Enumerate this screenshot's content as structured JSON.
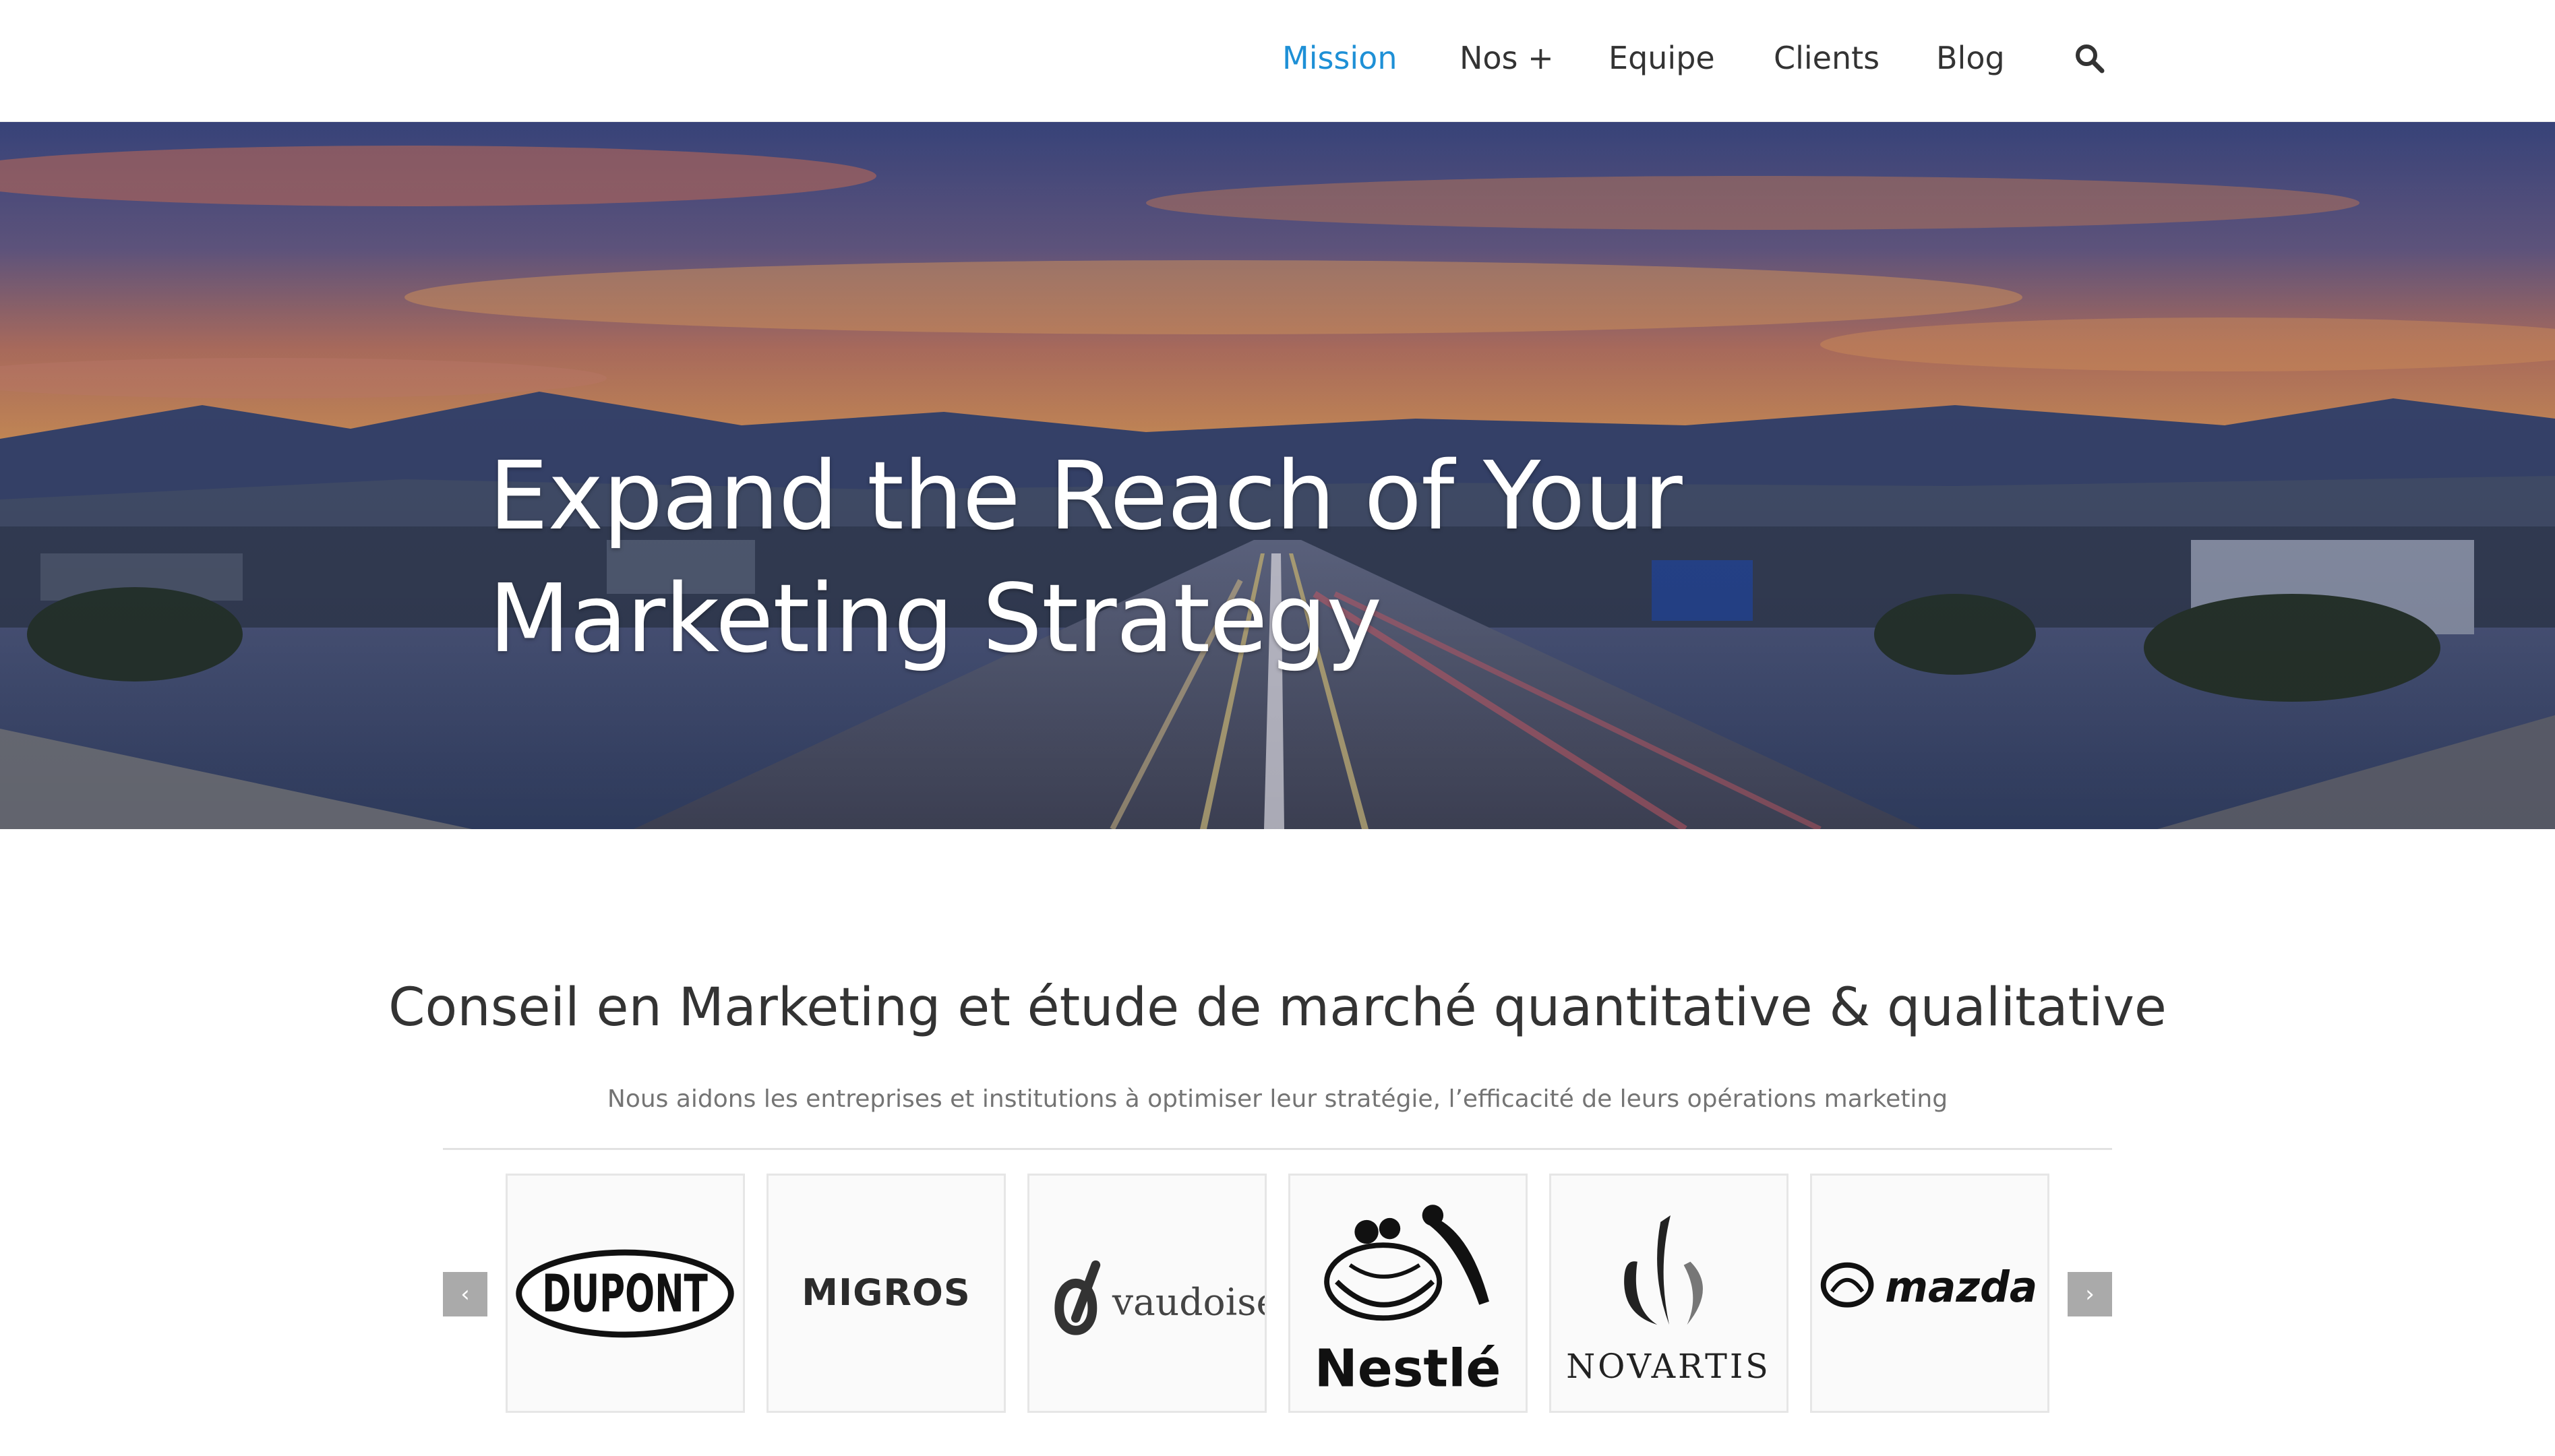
{
  "nav": {
    "items": [
      {
        "label": "Mission",
        "active": true
      },
      {
        "label": "Nos +",
        "active": false
      },
      {
        "label": "Equipe",
        "active": false
      },
      {
        "label": "Clients",
        "active": false
      },
      {
        "label": "Blog",
        "active": false
      }
    ],
    "search_icon": "search-icon",
    "active_color": "#1e90d6"
  },
  "hero": {
    "title": "Expand the Reach of Your Marketing Strategy"
  },
  "intro": {
    "title": "Conseil en Marketing et étude de marché quantitative & qualitative",
    "subtitle": "Nous aidons les entreprises et institutions à optimiser leur stratégie, l’efficacité de leurs opérations marketing"
  },
  "carousel": {
    "prev_label": "‹",
    "next_label": "›",
    "logos": [
      {
        "name": "DuPont",
        "text": "DUPONT"
      },
      {
        "name": "Migros",
        "text": "MIGROS"
      },
      {
        "name": "Vaudoise",
        "text": "vaudoise"
      },
      {
        "name": "Nestlé",
        "text": "Nestlé"
      },
      {
        "name": "Novartis",
        "text": "NOVARTIS"
      },
      {
        "name": "Mazda",
        "text": "mazda"
      }
    ]
  }
}
